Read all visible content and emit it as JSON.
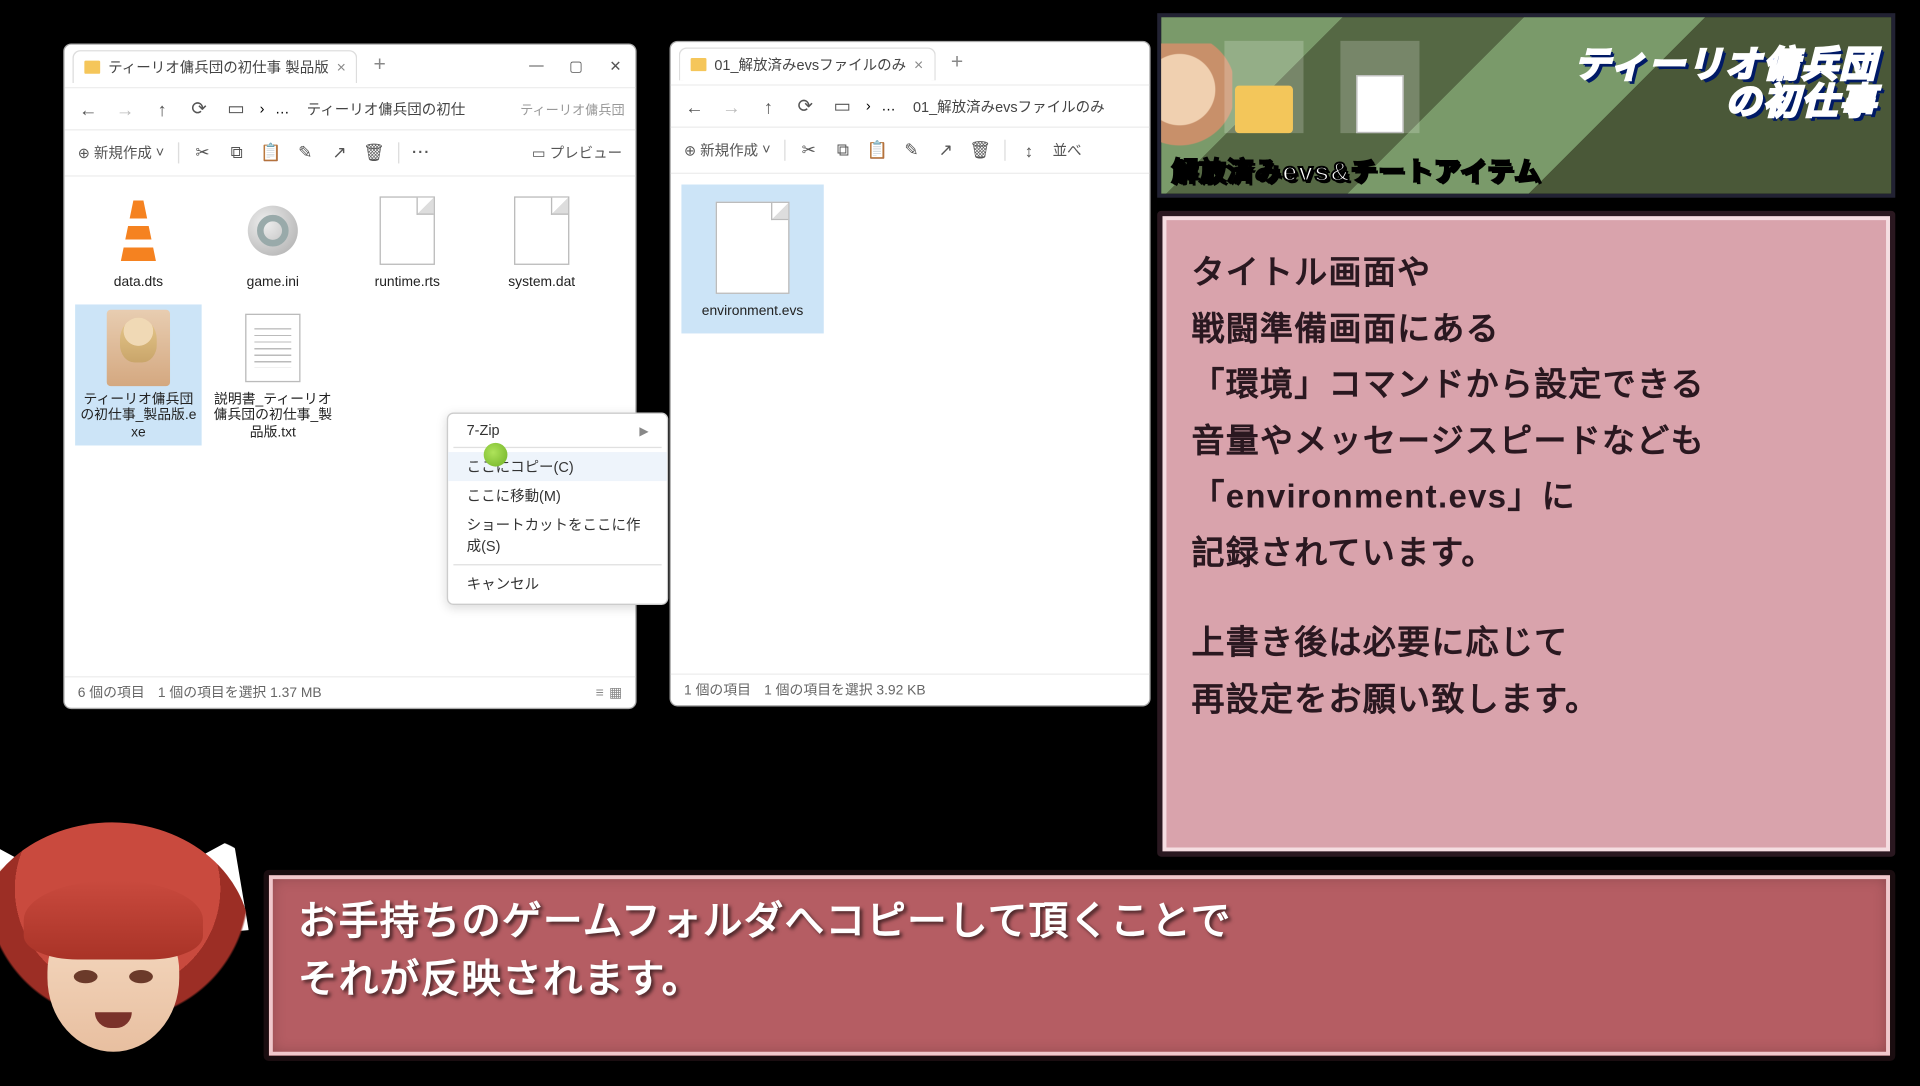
{
  "windows": {
    "left": {
      "tab_title": "ティーリオ傭兵団の初仕事 製品版",
      "breadcrumb": "ティーリオ傭兵団の初仕",
      "breadcrumb_hint": "ティーリオ傭兵団",
      "new_label": "新規作成",
      "preview_label": "プレビュー",
      "files": [
        {
          "name": "data.dts",
          "icon": "vlc"
        },
        {
          "name": "game.ini",
          "icon": "gear"
        },
        {
          "name": "runtime.rts",
          "icon": "blank"
        },
        {
          "name": "system.dat",
          "icon": "blank"
        },
        {
          "name": "ティーリオ傭兵団の初仕事_製品版.exe",
          "icon": "exe",
          "selected": true
        },
        {
          "name": "説明書_ティーリオ傭兵団の初仕事_製品版.txt",
          "icon": "txt"
        }
      ],
      "status_count": "6 個の項目",
      "status_sel": "1 個の項目を選択 1.37 MB"
    },
    "right": {
      "tab_title": "01_解放済みevsファイルのみ",
      "breadcrumb": "01_解放済みevsファイルのみ",
      "new_label": "新規作成",
      "sort_label": "並べ",
      "files": [
        {
          "name": "environment.evs",
          "icon": "blank",
          "selected": true
        }
      ],
      "status_count": "1 個の項目",
      "status_sel": "1 個の項目を選択 3.92 KB"
    }
  },
  "context_menu": {
    "items": {
      "sevenzip": "7-Zip",
      "copy_here": "ここにコピー(C)",
      "move_here": "ここに移動(M)",
      "shortcut_here": "ショートカットをここに作成(S)",
      "cancel": "キャンセル"
    }
  },
  "banner": {
    "title_line1": "ティーリオ傭兵団",
    "title_line2": "の初仕事",
    "subtitle": "解放済みevs&チートアイテム"
  },
  "info_panel": {
    "line1": "タイトル画面や",
    "line2": "戦闘準備画面にある",
    "line3": "「環境」コマンドから設定できる",
    "line4": "音量やメッセージスピードなども",
    "line5": "「environment.evs」に",
    "line6": "記録されています。",
    "line7": "上書き後は必要に応じて",
    "line8": "再設定をお願い致します。"
  },
  "dialog": {
    "line1": "お手持ちのゲームフォルダへコピーして頂くことで",
    "line2": "それが反映されます。"
  }
}
